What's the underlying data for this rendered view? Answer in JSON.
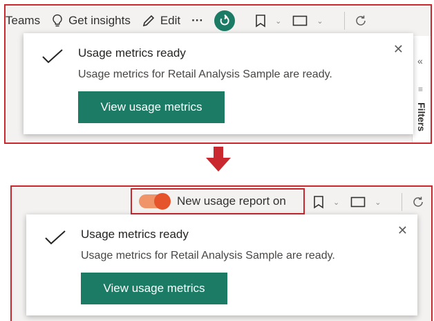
{
  "colors": {
    "highlight": "#c8282e",
    "primary_button": "#1c7b65",
    "toggle_on": "#e5542b",
    "refresh_icon": "#1c7b65"
  },
  "before": {
    "toolbar": {
      "teams_label": "Teams",
      "insights_label": "Get insights",
      "edit_label": "Edit",
      "more_label": "···"
    },
    "toast": {
      "title": "Usage metrics ready",
      "message": "Usage metrics for Retail Analysis Sample are ready.",
      "button_label": "View usage metrics"
    },
    "filters_pane": {
      "label": "Filters"
    }
  },
  "after": {
    "toggle": {
      "label": "New usage report on",
      "state": "on"
    },
    "toast": {
      "title": "Usage metrics ready",
      "message": "Usage metrics for Retail Analysis Sample are ready.",
      "button_label": "View usage metrics"
    }
  },
  "icons": [
    "lightbulb-icon",
    "pencil-icon",
    "refresh-icon",
    "bookmark-icon",
    "view-icon",
    "reload-icon",
    "check-icon",
    "close-icon",
    "down-arrow-icon"
  ]
}
